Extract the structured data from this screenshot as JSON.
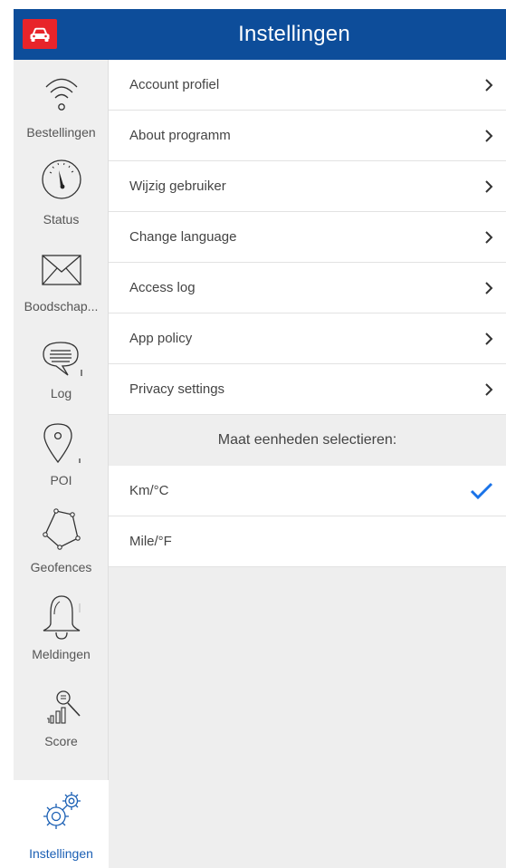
{
  "header": {
    "title": "Instellingen",
    "logo_icon": "car-icon",
    "color": "#0d4d9a",
    "logo_color": "#e8242a"
  },
  "sidebar": {
    "items": [
      {
        "label": "Bestellingen",
        "icon": "wifi-icon"
      },
      {
        "label": "Status",
        "icon": "speedometer-icon"
      },
      {
        "label": "Boodschap...",
        "icon": "envelope-icon"
      },
      {
        "label": "Log",
        "icon": "chat-bubble-icon"
      },
      {
        "label": "POI",
        "icon": "map-pin-icon"
      },
      {
        "label": "Geofences",
        "icon": "polygon-icon"
      },
      {
        "label": "Meldingen",
        "icon": "bell-icon"
      },
      {
        "label": "Score",
        "icon": "score-icon"
      },
      {
        "label": "Instellingen",
        "icon": "gears-icon",
        "active": true
      }
    ],
    "active_color": "#1a5fb4"
  },
  "settings": {
    "items": [
      {
        "label": "Account profiel"
      },
      {
        "label": "About programm"
      },
      {
        "label": "Wijzig gebruiker"
      },
      {
        "label": "Change language"
      },
      {
        "label": "Access log"
      },
      {
        "label": "App policy"
      },
      {
        "label": "Privacy settings"
      }
    ]
  },
  "units": {
    "heading": "Maat eenheden selectieren:",
    "options": [
      {
        "label": "Km/°C",
        "selected": true
      },
      {
        "label": "Mile/°F",
        "selected": false
      }
    ],
    "check_color": "#1a73e8"
  }
}
